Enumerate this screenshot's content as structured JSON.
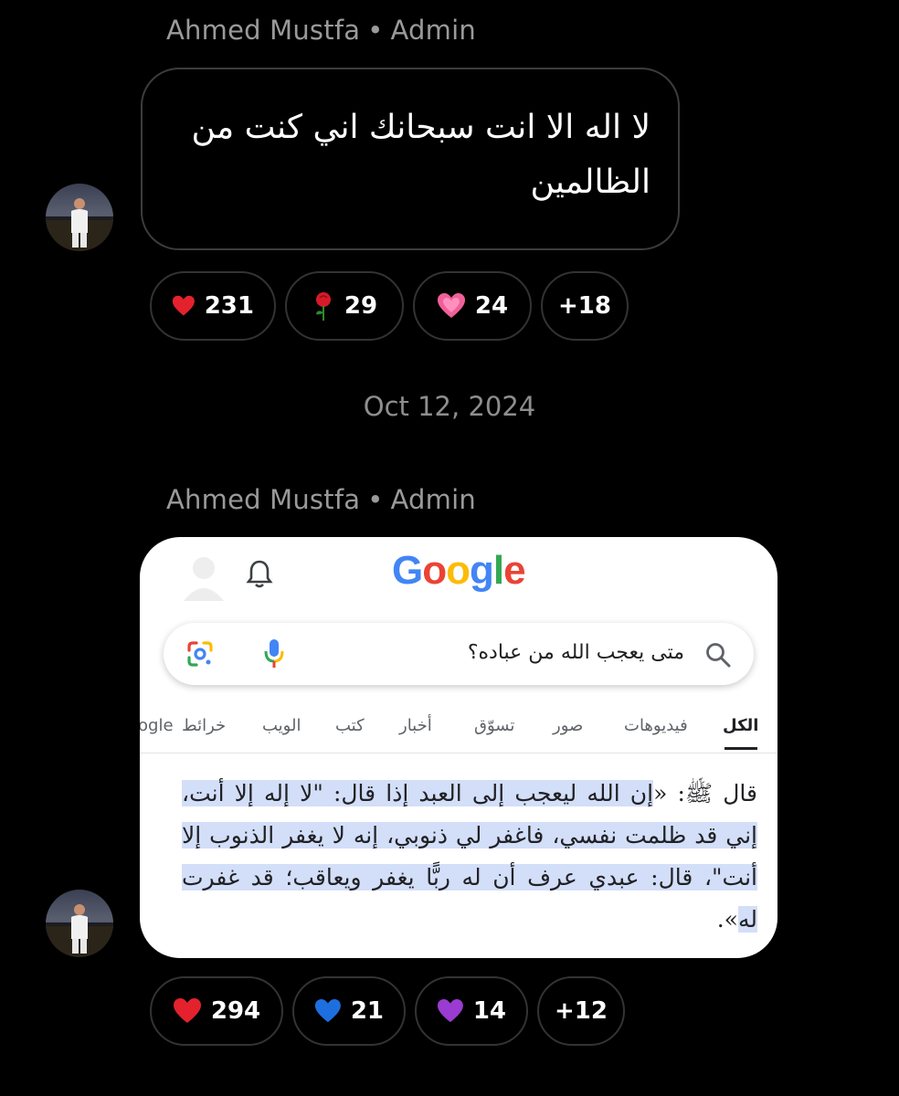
{
  "messages": [
    {
      "author": "Ahmed Mustfa",
      "role": "Admin",
      "text_line1": "لا اله الا انت سبحانك اني كنت من",
      "text_line2": "الظالمين",
      "reactions": [
        {
          "emoji": "red-heart",
          "count": "231"
        },
        {
          "emoji": "rose",
          "count": "29"
        },
        {
          "emoji": "growing-heart",
          "count": "24"
        },
        {
          "emoji": "more",
          "count": "+18"
        }
      ]
    },
    {
      "author": "Ahmed Mustfa",
      "role": "Admin",
      "reactions": [
        {
          "emoji": "red-heart",
          "count": "294"
        },
        {
          "emoji": "blue-heart",
          "count": "21"
        },
        {
          "emoji": "purple-heart",
          "count": "14"
        },
        {
          "emoji": "more",
          "count": "+12"
        }
      ]
    }
  ],
  "date_separator": "Oct 12, 2024",
  "screenshot": {
    "logo": "Google",
    "search_query": "متى يعجب الله من عباده؟",
    "tabs": [
      "الكل",
      "فيديوهات",
      "صور",
      "تسوّق",
      "أخبار",
      "كتب",
      "الويب",
      "خرائط",
      "ogle"
    ],
    "active_tab": "الكل",
    "hadith_prefix": "قال ﷺ: «",
    "hadith_highlighted": "إن الله ليعجب إلى العبد إذا قال: \"لا إله إلا أنت، إني قد ظلمت نفسي، فاغفر لي ذنوبي، إنه لا يغفر الذنوب إلا أنت\"، قال: عبدي عرف أن له ربًّا يغفر ويعاقب؛ قد غفرت له",
    "hadith_suffix": "».",
    "colors": {
      "google_blue": "#4285F4",
      "google_red": "#EA4335",
      "google_yellow": "#FBBC05",
      "google_green": "#34A853",
      "highlight": "#d3def8"
    }
  }
}
